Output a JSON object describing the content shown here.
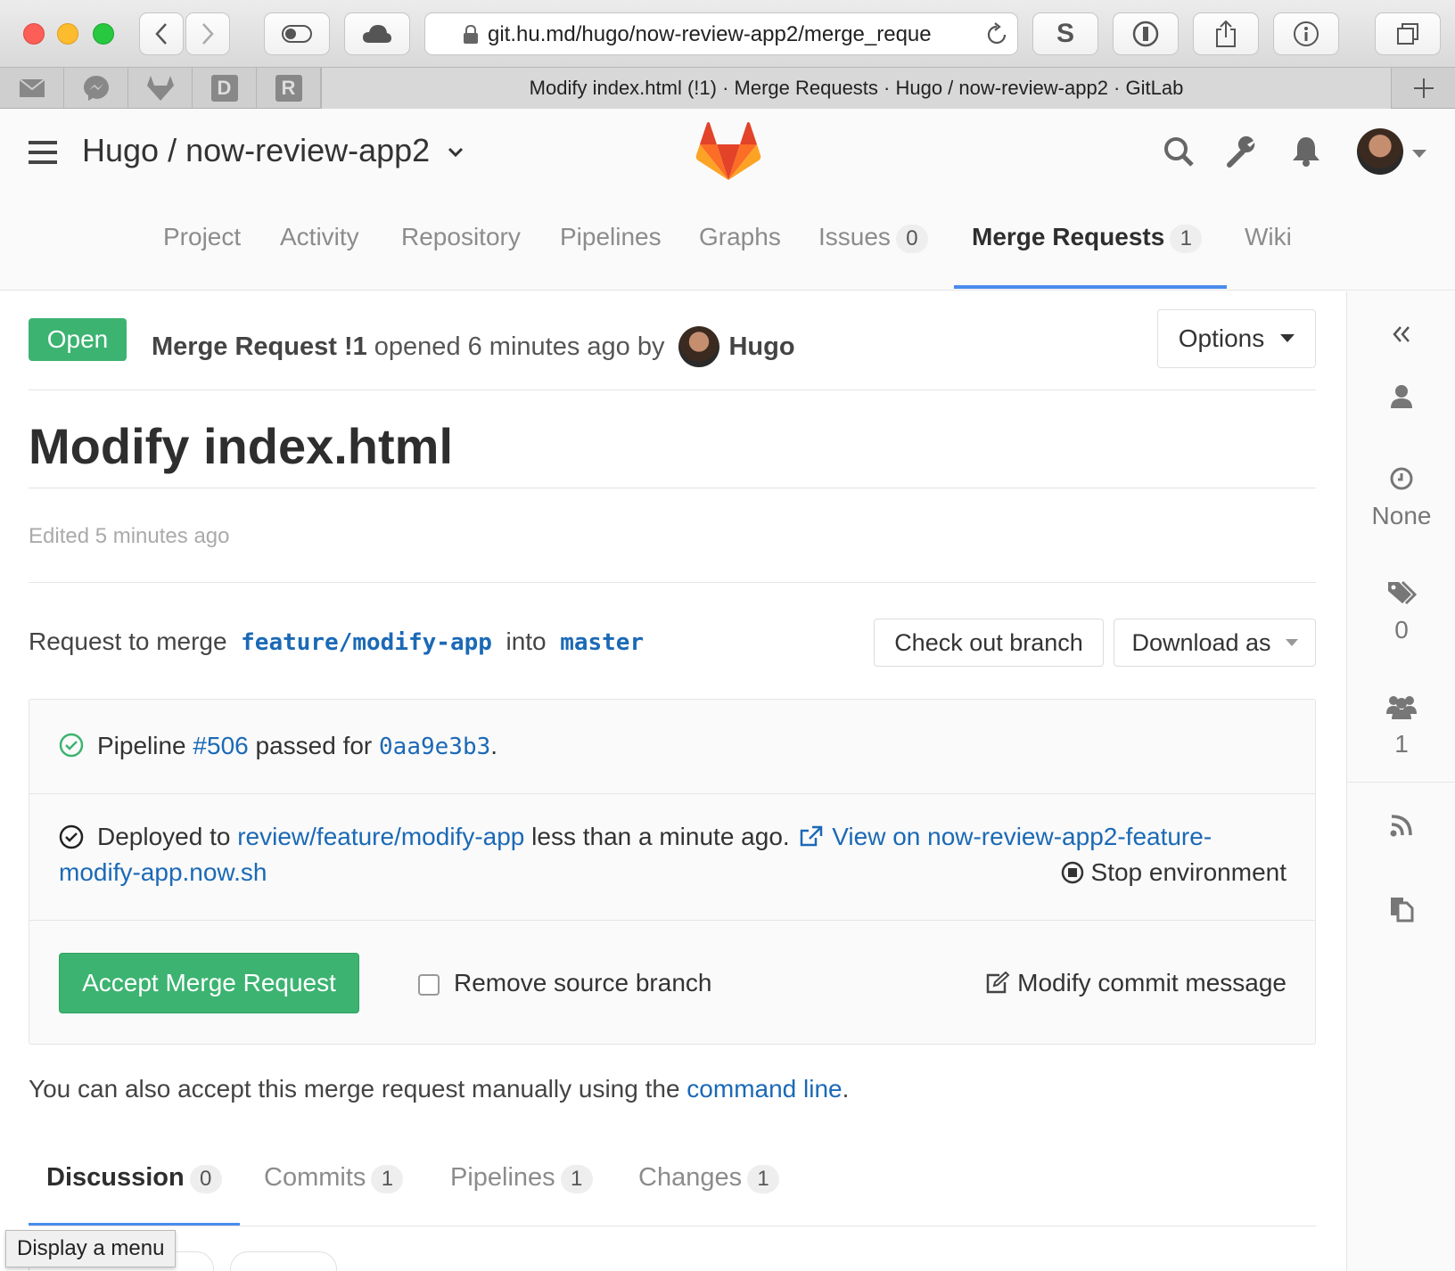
{
  "browser": {
    "url": "git.hu.md/hugo/now-review-app2/merge_reque",
    "tab_title": "Modify index.html (!1) · Merge Requests · Hugo / now-review-app2 · GitLab",
    "favorites": [
      "mail",
      "messenger",
      "gitlab",
      "D",
      "R"
    ]
  },
  "header": {
    "project": "Hugo / now-review-app2"
  },
  "nav": {
    "items": [
      {
        "label": "Project"
      },
      {
        "label": "Activity"
      },
      {
        "label": "Repository"
      },
      {
        "label": "Pipelines"
      },
      {
        "label": "Graphs"
      },
      {
        "label": "Issues",
        "count": "0"
      },
      {
        "label": "Merge Requests",
        "count": "1",
        "active": true
      },
      {
        "label": "Wiki"
      }
    ]
  },
  "mr": {
    "status": "Open",
    "ref": "Merge Request !1",
    "opened": "opened 6 minutes ago by",
    "author": "Hugo",
    "options_label": "Options",
    "title": "Modify index.html",
    "edited": "Edited 5 minutes ago",
    "merge_prefix": "Request to merge",
    "source_branch": "feature/modify-app",
    "merge_into": "into",
    "target_branch": "master",
    "checkout_label": "Check out branch",
    "download_label": "Download as"
  },
  "widget": {
    "pipeline_prefix": "Pipeline",
    "pipeline_id": "#506",
    "pipeline_mid": "passed for",
    "commit": "0aa9e3b3",
    "deploy_prefix": "Deployed to",
    "environment": "review/feature/modify-app",
    "deploy_time": "less than a minute ago.",
    "view_link_1": "View on now-review-app2-feature-",
    "view_link_2": "modify-app.now.sh",
    "stop_label": "Stop environment",
    "accept_label": "Accept Merge Request",
    "remove_branch_label": "Remove source branch",
    "modify_commit_label": "Modify commit message"
  },
  "manual": {
    "text": "You can also accept this merge request manually using the",
    "link": "command line"
  },
  "tabs": [
    {
      "label": "Discussion",
      "count": "0",
      "active": true
    },
    {
      "label": "Commits",
      "count": "1"
    },
    {
      "label": "Pipelines",
      "count": "1"
    },
    {
      "label": "Changes",
      "count": "1"
    }
  ],
  "sidebar": {
    "milestone": "None",
    "labels_count": "0",
    "participants_count": "1"
  },
  "tooltip": "Display a menu",
  "colors": {
    "green": "#3cb371",
    "link": "#1b69b6",
    "nav_underline": "#4a8bee"
  }
}
